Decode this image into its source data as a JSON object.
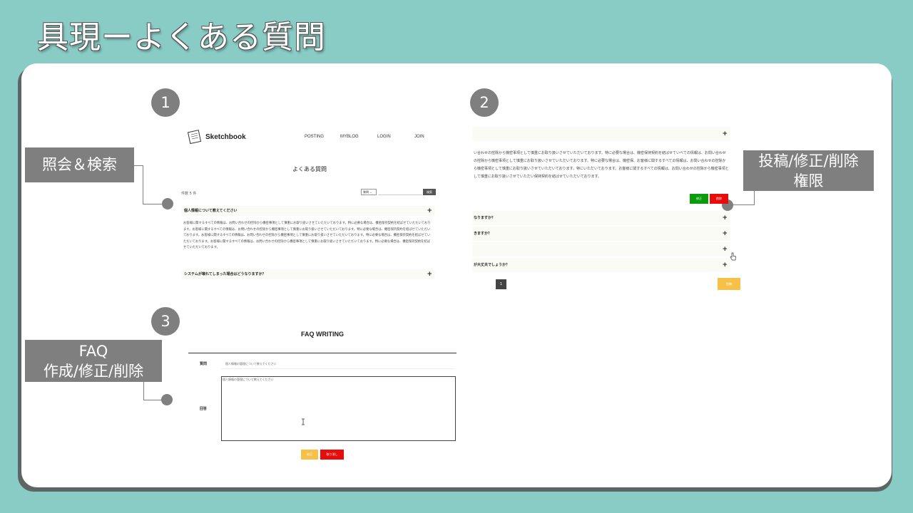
{
  "slide": {
    "title": "具現ーよくある質問"
  },
  "badges": [
    "1",
    "2",
    "3"
  ],
  "callouts": {
    "search": "照会＆検索",
    "manage_line1": "投稿/修正/削除",
    "manage_line2": "権限",
    "write_line1": "FAQ",
    "write_line2": "作成/修正/削除"
  },
  "panel1": {
    "brand": "Sketchbook",
    "nav": [
      "POSTING",
      "MYBLOG",
      "LOGIN",
      "JOIN"
    ],
    "heading": "よくある質問",
    "count": "件数 5 件",
    "select_value": "質問",
    "search_button": "検索",
    "q1": "個人情報について教えてください",
    "answer": "お客様に関するすべての情報は、お問い合わせの控除から機密事項として慎重にお取り扱いさせていただいております。特に必要な場合は、機密保持契約を結ばせていただいております。お客様に関するすべての情報は、お問い合わせの控除から機密事項として慎重にお取り扱いさせていただいております。特に必要な場合は、機密保持契約を結ばせていただいております。お客様に関するすべての情報は、お問い合わせの控除から機密事項として慎重にお取り扱いさせていただいております。特に必要な場合は、機密保持契約を結ばせていただいております。お客様に関するすべての情報は、お問い合わせの控除から機密事項として慎重にお取り扱いさせていただいております。特に必要な場合は、機密保持契約を結ばせていただいております。",
    "q2": "システムが壊れてしまった場合はどうなりますか？",
    "plus": "+"
  },
  "panel2": {
    "answer": "い合わせの控除から機密事項として慎重にお取り扱いさせていただいております。特に必要な場合は、機密保持契約を結ばせていべての情報は、お問い合わせの控除から機密事項として慎重にお取り扱いさせていただいております。特に必要な場合は、機密保、お客様に関するすべての情報は、お問い合わせの控除から機密事項として慎重にお取り扱いさせていただいております。特にいただいております。お客様に関するすべての情報は、お問い合わせの控除から機密事項として慎重にお取り扱いさせていただい保持契約を結ばせていただいております。",
    "edit": "修正",
    "delete": "削除",
    "rows": [
      "なりますか？",
      "きますか？",
      "",
      "が大丈夫でしょうか？"
    ],
    "page": "1",
    "post": "投稿",
    "plus": "+"
  },
  "panel3": {
    "title": "FAQ WRITING",
    "q_label": "質問",
    "a_label": "回答",
    "q_value": "個人情報の管理について教えてください",
    "a_value": "個人情報の管理について教えてください",
    "submit": "修正",
    "cancel": "取り消し"
  }
}
